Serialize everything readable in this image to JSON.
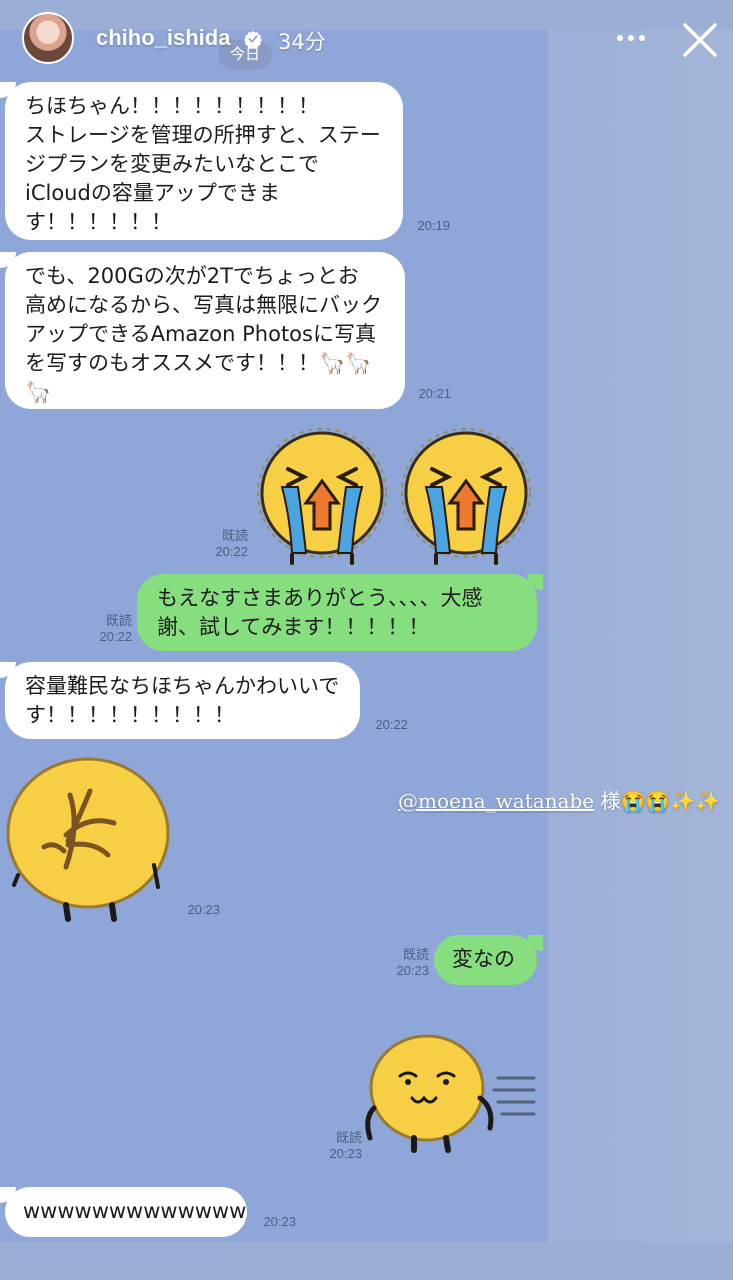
{
  "story": {
    "username": "chiho_ishida",
    "time_ago": "34分",
    "verified": true,
    "mention_handle": "@moena_watanabe",
    "mention_suffix": " 様😭😭✨✨"
  },
  "chat": {
    "date_chip": "今日",
    "read_label": "既読",
    "messages": [
      {
        "from": "other",
        "type": "text",
        "text": "ちほちゃん！！！！！！！！！\nストレージを管理の所押すと、ステー\nジプランを変更みたいなとこで\niCloudの容量アップできま\nす！！！！！！",
        "time": "20:19"
      },
      {
        "from": "other",
        "type": "text",
        "text": "でも、200Gの次が2Tでちょっとお\n高めになるから、写真は無限にバック\nアップできるAmazon Photosに写真\nを写すのもオススメです！！！🦙🦙\n🦙",
        "time": "20:21"
      },
      {
        "from": "me",
        "type": "sticker",
        "sticker": "crying-face-stickers",
        "time": "20:22"
      },
      {
        "from": "me",
        "type": "text",
        "text": "もえなすさまありがとう、、、、大感\n謝、試してみます！！！！！",
        "time": "20:22"
      },
      {
        "from": "other",
        "type": "text",
        "text": "容量難民なちほちゃんかわいいで\nす！！！！！！！！！",
        "time": "20:22"
      },
      {
        "from": "other",
        "type": "sticker",
        "sticker": "back-turned-sticker",
        "time": "20:23"
      },
      {
        "from": "me",
        "type": "text",
        "text": "変なの",
        "time": "20:23"
      },
      {
        "from": "me",
        "type": "sticker",
        "sticker": "smirk-running-sticker",
        "time": "20:23"
      },
      {
        "from": "other",
        "type": "text",
        "text": "wwwwwwwwwwwww",
        "time": "20:23"
      }
    ]
  },
  "colors": {
    "sent_bubble": "#86de7e",
    "received_bubble": "#ffffff",
    "chat_background": "#8ea6d8"
  }
}
